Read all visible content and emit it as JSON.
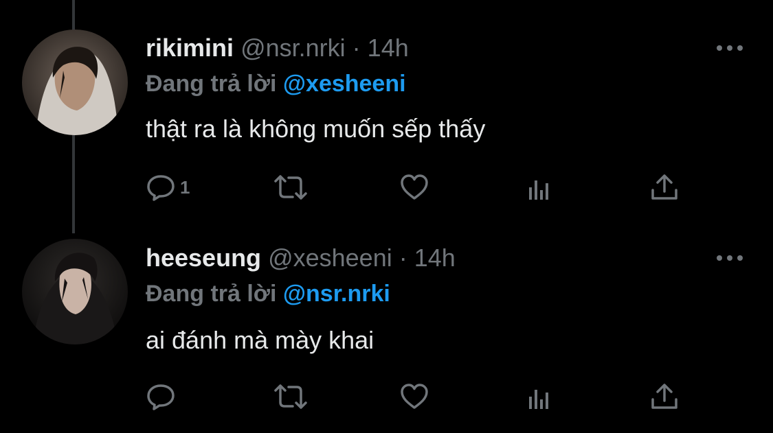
{
  "tweets": [
    {
      "display_name": "rikimini",
      "handle": "@nsr.nrki",
      "separator": "·",
      "time": "14h",
      "reply_prefix": "Đang trả lời",
      "reply_to": "@xesheeni",
      "text": "thật ra là không muốn sếp thấy",
      "reply_count": "1",
      "more_icon": "more-horizontal-icon"
    },
    {
      "display_name": "heeseung",
      "handle": "@xesheeni",
      "separator": "·",
      "time": "14h",
      "reply_prefix": "Đang trả lời",
      "reply_to": "@nsr.nrki",
      "text": "ai đánh mà mày khai",
      "reply_count": "",
      "more_icon": "more-horizontal-icon"
    }
  ],
  "icons": [
    "reply-icon",
    "retweet-icon",
    "like-icon",
    "stats-icon",
    "share-icon"
  ],
  "colors": {
    "background": "#000000",
    "text": "#e7e9ea",
    "secondary": "#71767b",
    "mention": "#1d9bf0",
    "thread_line": "#333639"
  }
}
